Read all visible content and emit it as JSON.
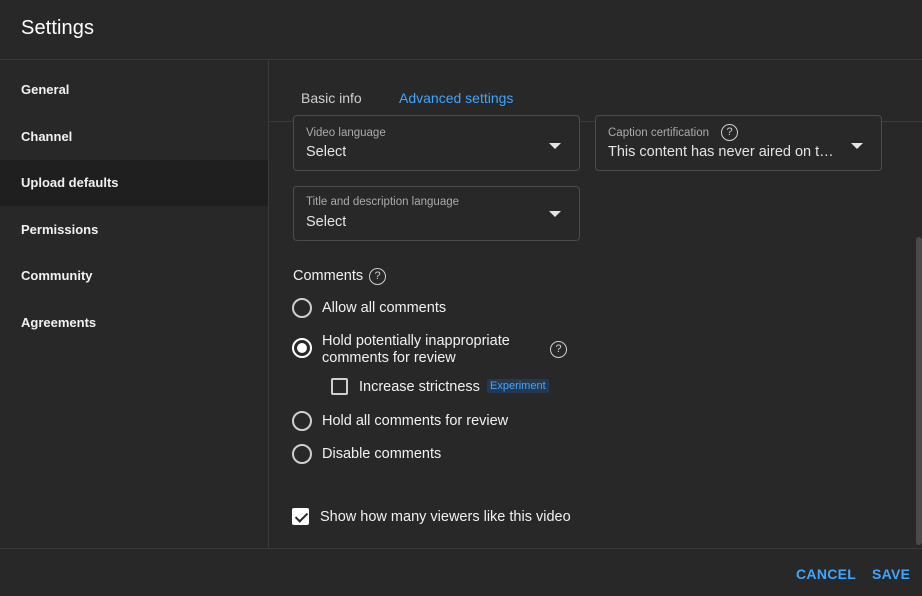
{
  "header": {
    "title": "Settings"
  },
  "sidebar": {
    "items": [
      {
        "label": "General"
      },
      {
        "label": "Channel"
      },
      {
        "label": "Upload defaults"
      },
      {
        "label": "Permissions"
      },
      {
        "label": "Community"
      },
      {
        "label": "Agreements"
      }
    ],
    "active_index": 2
  },
  "tabs": [
    {
      "label": "Basic info"
    },
    {
      "label": "Advanced settings"
    }
  ],
  "active_tab": 1,
  "video_language": {
    "label": "Video language",
    "value": "Select"
  },
  "caption_certification": {
    "label": "Caption certification",
    "value": "This content has never aired on t…"
  },
  "title_description_language": {
    "label": "Title and description language",
    "value": "Select"
  },
  "comments": {
    "title": "Comments",
    "options": [
      {
        "label": "Allow all comments",
        "checked": false
      },
      {
        "label_line1": "Hold potentially inappropriate",
        "label_line2": "comments for review",
        "checked": true
      },
      {
        "label": "Hold all comments for review",
        "checked": false
      },
      {
        "label": "Disable comments",
        "checked": false
      }
    ],
    "increase_strictness": {
      "label": "Increase strictness",
      "badge": "Experiment",
      "checked": false
    }
  },
  "show_likes": {
    "label": "Show how many viewers like this video",
    "checked": true
  },
  "footer": {
    "cancel": "CANCEL",
    "save": "SAVE"
  },
  "help_glyph": "?",
  "colors": {
    "accent": "#3ea6ff",
    "background": "#282828",
    "active_sidebar": "#1f1f1f"
  }
}
